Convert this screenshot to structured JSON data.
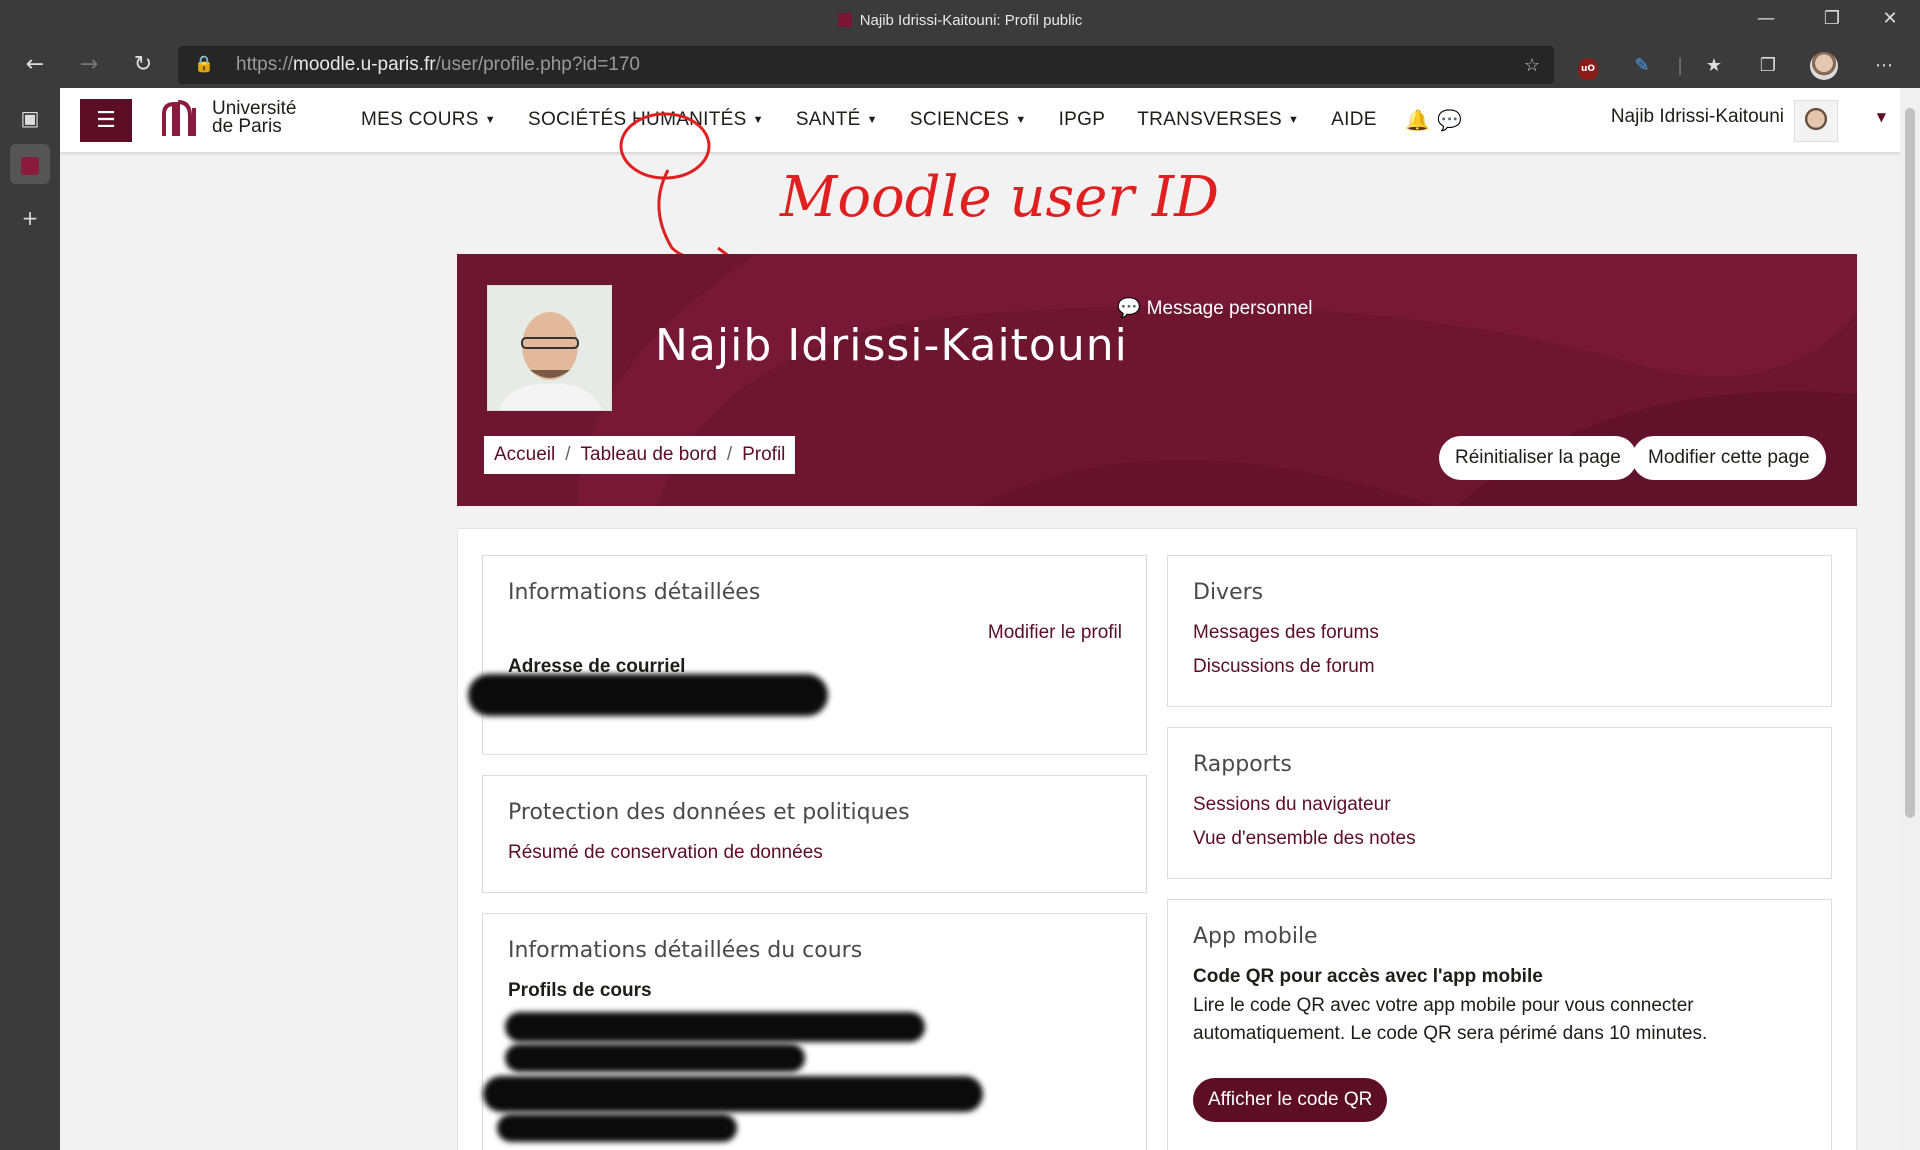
{
  "browser": {
    "window_title": "Najib Idrissi-Kaitouni: Profil public",
    "url_scheme": "https://",
    "url_host": "moodle.u-paris.fr",
    "url_path": "/user/profile.php?id=170"
  },
  "moodle_nav": {
    "logo_line1": "Université",
    "logo_line2": "de Paris",
    "menu": [
      {
        "label": "MES COURS",
        "has_dropdown": true
      },
      {
        "label": "SOCIÉTÉS HUMANITÉS",
        "has_dropdown": true
      },
      {
        "label": "SANTÉ",
        "has_dropdown": true
      },
      {
        "label": "SCIENCES",
        "has_dropdown": true
      },
      {
        "label": "IPGP",
        "has_dropdown": false
      },
      {
        "label": "TRANSVERSES",
        "has_dropdown": true
      },
      {
        "label": "AIDE",
        "has_dropdown": false
      }
    ],
    "user_name": "Najib Idrissi-Kaitouni"
  },
  "annotation": {
    "text": "Moodle user ID",
    "color": "#e02020"
  },
  "header": {
    "full_name": "Najib Idrissi-Kaitouni",
    "message_label": "Message personnel",
    "breadcrumb": [
      "Accueil",
      "Tableau de bord",
      "Profil"
    ],
    "reset_button": "Réinitialiser la page",
    "edit_button": "Modifier cette page",
    "banner_color": "#6e1530"
  },
  "cards": {
    "details": {
      "title": "Informations détaillées",
      "edit_link": "Modifier le profil",
      "email_label": "Adresse de courriel"
    },
    "privacy": {
      "title": "Protection des données et politiques",
      "link": "Résumé de conservation de données"
    },
    "course_details": {
      "title": "Informations détaillées du cours",
      "profiles_label": "Profils de cours"
    },
    "misc": {
      "title": "Divers",
      "links": [
        "Messages des forums",
        "Discussions de forum"
      ]
    },
    "reports": {
      "title": "Rapports",
      "links": [
        "Sessions du navigateur",
        "Vue d'ensemble des notes"
      ]
    },
    "mobile": {
      "title": "App mobile",
      "qr_heading": "Code QR pour accès avec l'app mobile",
      "qr_text": "Lire le code QR avec votre app mobile pour vous connecter automatiquement. Le code QR sera périmé dans 10 minutes.",
      "qr_button": "Afficher le code QR"
    }
  },
  "colors": {
    "brand": "#5c0f24",
    "link": "#5c0f24"
  }
}
